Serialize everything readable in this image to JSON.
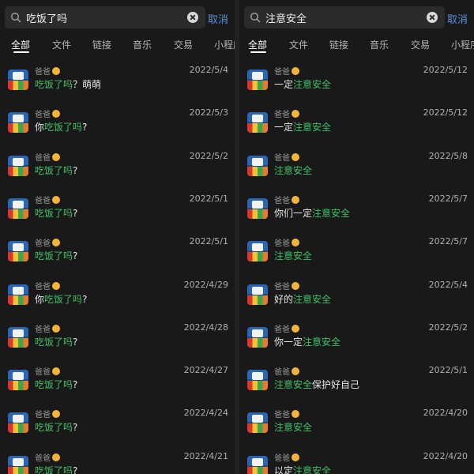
{
  "panes": [
    {
      "query": "吃饭了吗",
      "cancel_label": "取消",
      "tabs": [
        "全部",
        "文件",
        "链接",
        "音乐",
        "交易",
        "小程序"
      ],
      "results": [
        {
          "sender": "爸爸",
          "date": "2022/5/4",
          "pre": "",
          "hl": "吃饭了吗",
          "post": "？萌萌"
        },
        {
          "sender": "爸爸",
          "date": "2022/5/3",
          "pre": "你",
          "hl": "吃饭了吗",
          "post": "?"
        },
        {
          "sender": "爸爸",
          "date": "2022/5/2",
          "pre": "",
          "hl": "吃饭了吗",
          "post": "?"
        },
        {
          "sender": "爸爸",
          "date": "2022/5/1",
          "pre": "",
          "hl": "吃饭了吗",
          "post": "?"
        },
        {
          "sender": "爸爸",
          "date": "2022/5/1",
          "pre": "",
          "hl": "吃饭了吗",
          "post": "?"
        },
        {
          "sender": "爸爸",
          "date": "2022/4/29",
          "pre": "你",
          "hl": "吃饭了吗",
          "post": "?"
        },
        {
          "sender": "爸爸",
          "date": "2022/4/28",
          "pre": "",
          "hl": "吃饭了吗",
          "post": "?"
        },
        {
          "sender": "爸爸",
          "date": "2022/4/27",
          "pre": "",
          "hl": "吃饭了吗",
          "post": "?"
        },
        {
          "sender": "爸爸",
          "date": "2022/4/24",
          "pre": "",
          "hl": "吃饭了吗",
          "post": "?"
        },
        {
          "sender": "爸爸",
          "date": "2022/4/21",
          "pre": "",
          "hl": "吃饭了吗",
          "post": "?"
        }
      ]
    },
    {
      "query": "注意安全",
      "cancel_label": "取消",
      "tabs": [
        "全部",
        "文件",
        "链接",
        "音乐",
        "交易",
        "小程序"
      ],
      "results": [
        {
          "sender": "爸爸",
          "date": "2022/5/12",
          "pre": "一定",
          "hl": "注意安全",
          "post": ""
        },
        {
          "sender": "爸爸",
          "date": "2022/5/12",
          "pre": "一定",
          "hl": "注意安全",
          "post": ""
        },
        {
          "sender": "爸爸",
          "date": "2022/5/8",
          "pre": "",
          "hl": "注意安全",
          "post": ""
        },
        {
          "sender": "爸爸",
          "date": "2022/5/7",
          "pre": "你们一定",
          "hl": "注意安全",
          "post": ""
        },
        {
          "sender": "爸爸",
          "date": "2022/5/7",
          "pre": "",
          "hl": "注意安全",
          "post": ""
        },
        {
          "sender": "爸爸",
          "date": "2022/5/4",
          "pre": "好的",
          "hl": "注意安全",
          "post": ""
        },
        {
          "sender": "爸爸",
          "date": "2022/5/2",
          "pre": "你一定",
          "hl": "注意安全",
          "post": ""
        },
        {
          "sender": "爸爸",
          "date": "2022/5/1",
          "pre": "",
          "hl": "注意安全",
          "post": "保护好自己"
        },
        {
          "sender": "爸爸",
          "date": "2022/4/20",
          "pre": "",
          "hl": "注意安全",
          "post": ""
        },
        {
          "sender": "爸爸",
          "date": "2022/4/20",
          "pre": "以定",
          "hl": "注意安全",
          "post": ""
        }
      ]
    }
  ],
  "icons": {
    "search": "search-icon",
    "clear": "clear-icon",
    "sender_emoji": "smiling-face-icon",
    "avatar": "avatar"
  },
  "colors": {
    "background": "#191919",
    "highlight": "#3fc266",
    "cancel": "#5b8dd8",
    "active_tab": "#ffffff"
  }
}
